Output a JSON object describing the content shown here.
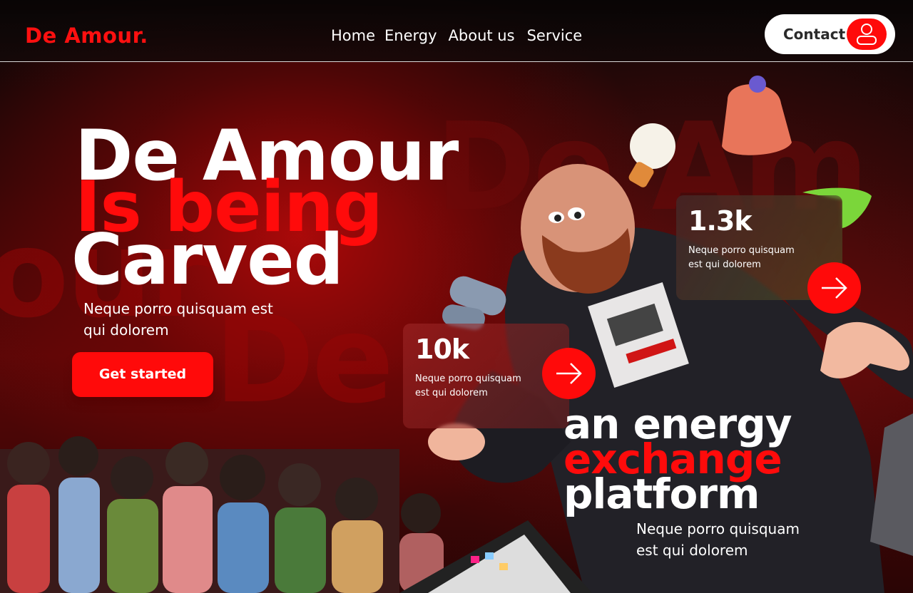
{
  "nav": {
    "logo": "De Amour.",
    "menu": [
      "Home",
      "Energy",
      "About us",
      "Service"
    ],
    "contact_label": "Contact"
  },
  "hero": {
    "line1": "De Amour",
    "line2": "Is being",
    "line3": "Carved",
    "subtitle": "Neque porro quisquam est qui dolorem",
    "cta_label": "Get started",
    "watermarks": [
      "De Am",
      "our",
      "De"
    ]
  },
  "stats": [
    {
      "value": "1.3k",
      "description": "Neque porro quisquam est qui dolorem"
    },
    {
      "value": "10k",
      "description": "Neque porro quisquam est qui dolorem"
    }
  ],
  "platform": {
    "line1": "an energy",
    "line2": "exchange",
    "line3": "platform",
    "subtitle": "Neque porro quisquam est qui dolorem"
  },
  "colors": {
    "accent": "#ff0a0a",
    "background": "#0b0506",
    "text": "#ffffff"
  },
  "icons": {
    "contact": "user-icon",
    "card_action": "arrow-right-icon"
  }
}
